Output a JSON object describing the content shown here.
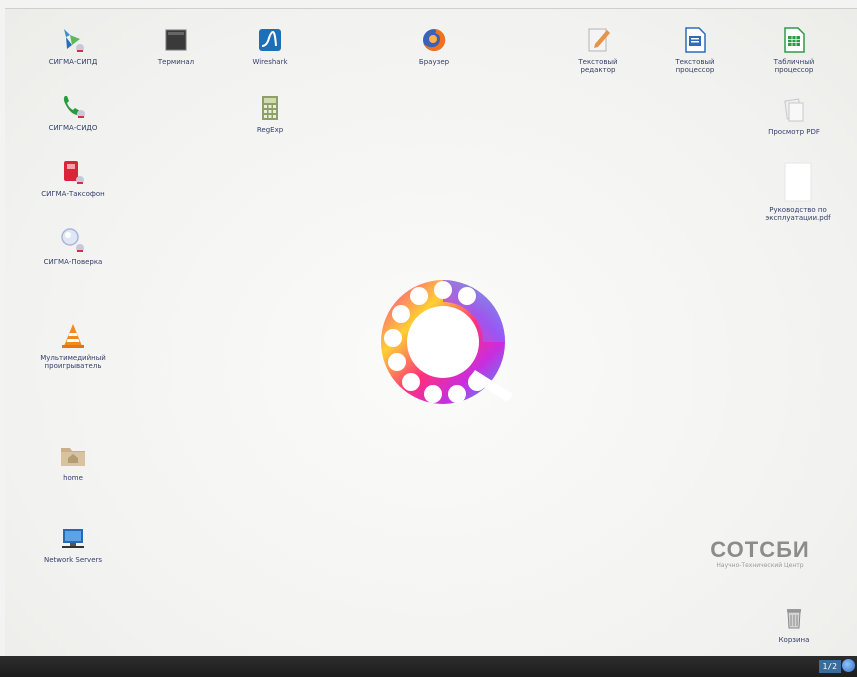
{
  "desktop": {
    "icons": [
      {
        "label": "СИГМА-СИПД"
      },
      {
        "label": "СИГМА-СИДО"
      },
      {
        "label": "СИГМА-Таксофон"
      },
      {
        "label": "СИГМА-Поверка"
      },
      {
        "label": "Мультимедийный\nпроигрыватель"
      },
      {
        "label": "home"
      },
      {
        "label": "Network Servers"
      },
      {
        "label": "Терминал"
      },
      {
        "label": "Wireshark"
      },
      {
        "label": "RegExp"
      },
      {
        "label": "Браузер"
      },
      {
        "label": "Текстовый\nредактор"
      },
      {
        "label": "Текстовый\nпроцессор"
      },
      {
        "label": "Табличный\nпроцессор"
      },
      {
        "label": "Просмотр PDF"
      },
      {
        "label": "Руководство по\nэксплуатации.pdf"
      },
      {
        "label": "Корзина"
      }
    ]
  },
  "branding": {
    "name": "СОТСБИ",
    "subtitle": "Научно-Технический Центр"
  },
  "taskbar": {
    "pager": "1/2"
  },
  "colors": {
    "label_text": "#34406a",
    "taskbar": "#1d1d1d",
    "pager_bg": "#3a6d9c"
  }
}
